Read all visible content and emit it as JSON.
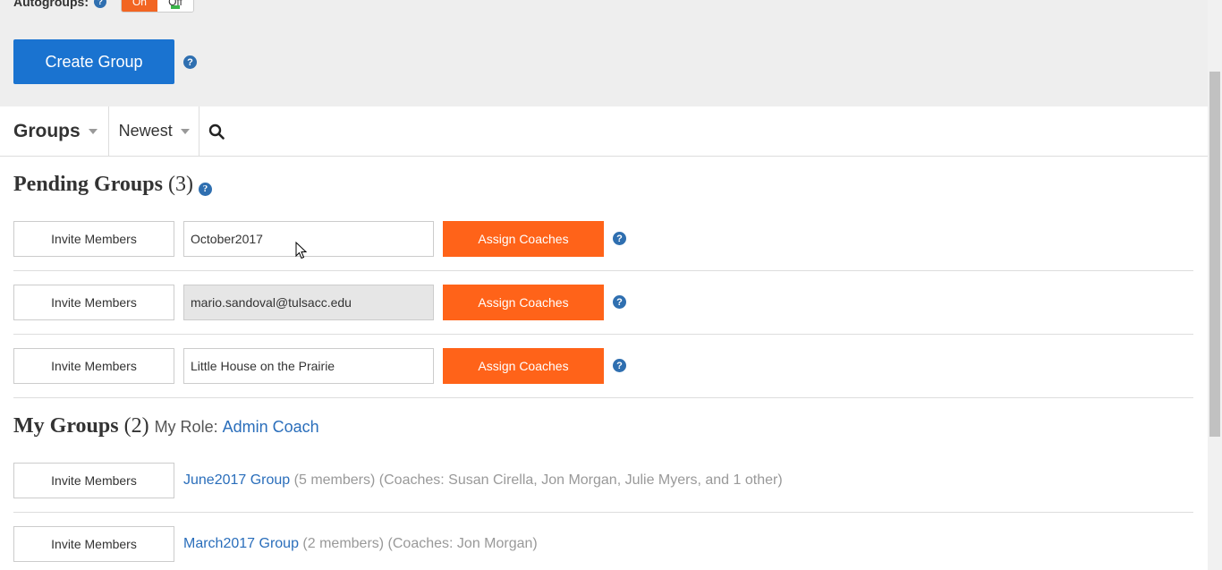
{
  "top": {
    "autogroups_label": "Autogroups:",
    "toggle_on": "On",
    "toggle_off": "Off",
    "create_label": "Create Group"
  },
  "toolbar": {
    "groups_label": "Groups",
    "sort_label": "Newest"
  },
  "pending": {
    "title": "Pending Groups",
    "count": "(3)",
    "rows": [
      {
        "invite": "Invite Members",
        "name": "October2017",
        "assign": "Assign Coaches"
      },
      {
        "invite": "Invite Members",
        "name": "mario.sandoval@tulsacc.edu",
        "assign": "Assign Coaches"
      },
      {
        "invite": "Invite Members",
        "name": "Little House on the Prairie",
        "assign": "Assign Coaches"
      }
    ]
  },
  "my_groups": {
    "title": "My Groups",
    "count": "(2)",
    "role_label": "My Role:",
    "role_value": "Admin Coach",
    "rows": [
      {
        "invite": "Invite Members",
        "name": "June2017 Group",
        "details": "(5 members) (Coaches: Susan Cirella, Jon Morgan, Julie Myers, and 1 other)"
      },
      {
        "invite": "Invite Members",
        "name": "March2017 Group",
        "details": "(2 members) (Coaches: Jon Morgan)"
      }
    ]
  },
  "colors": {
    "primary": "#1a73d0",
    "accent": "#ff6319",
    "link": "#2a6ebb"
  }
}
